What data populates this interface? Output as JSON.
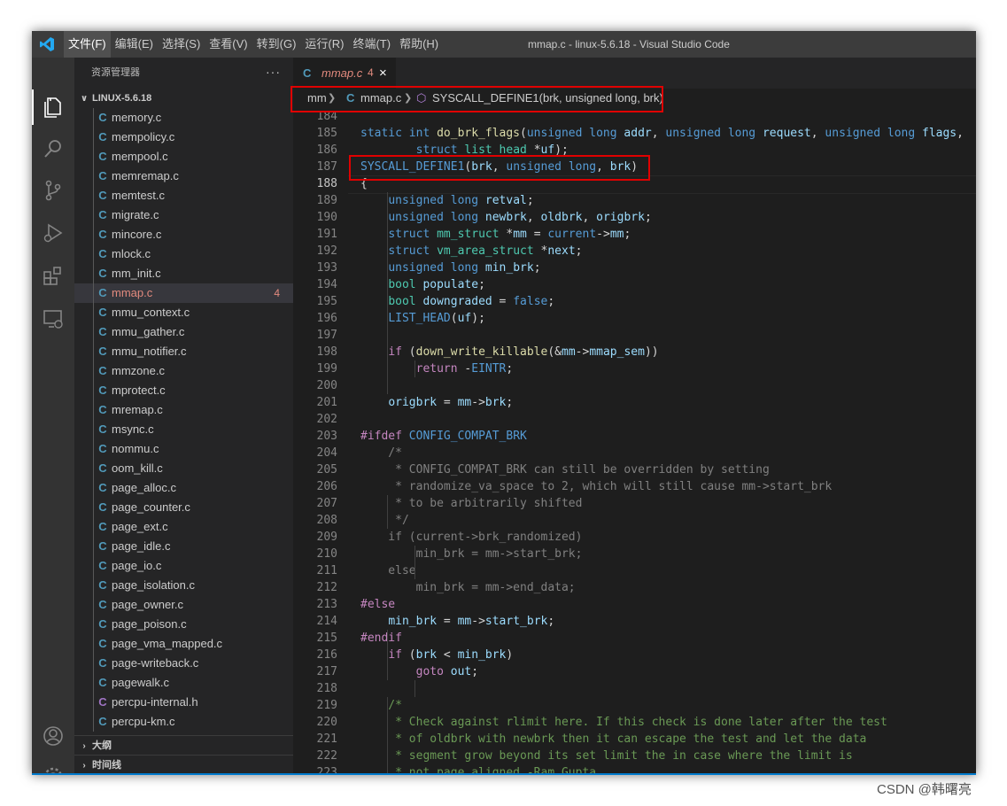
{
  "window": {
    "title": "mmap.c - linux-5.6.18 - Visual Studio Code"
  },
  "menu": [
    {
      "label": "文件(F)",
      "active": true
    },
    {
      "label": "编辑(E)"
    },
    {
      "label": "选择(S)"
    },
    {
      "label": "查看(V)"
    },
    {
      "label": "转到(G)"
    },
    {
      "label": "运行(R)"
    },
    {
      "label": "终端(T)"
    },
    {
      "label": "帮助(H)"
    }
  ],
  "activity_icons": [
    "files-icon",
    "search-icon",
    "source-control-icon",
    "run-debug-icon",
    "extensions-icon",
    "remote-explorer-icon",
    "account-icon",
    "settings-gear-icon"
  ],
  "sidebar": {
    "header": "资源管理器",
    "more": "···",
    "folder": "LINUX-5.6.18",
    "files": [
      {
        "icon": "C",
        "name": "memory.c"
      },
      {
        "icon": "C",
        "name": "mempolicy.c"
      },
      {
        "icon": "C",
        "name": "mempool.c"
      },
      {
        "icon": "C",
        "name": "memremap.c"
      },
      {
        "icon": "C",
        "name": "memtest.c"
      },
      {
        "icon": "C",
        "name": "migrate.c"
      },
      {
        "icon": "C",
        "name": "mincore.c"
      },
      {
        "icon": "C",
        "name": "mlock.c"
      },
      {
        "icon": "C",
        "name": "mm_init.c"
      },
      {
        "icon": "C",
        "name": "mmap.c",
        "active": true,
        "badge": "4"
      },
      {
        "icon": "C",
        "name": "mmu_context.c"
      },
      {
        "icon": "C",
        "name": "mmu_gather.c"
      },
      {
        "icon": "C",
        "name": "mmu_notifier.c"
      },
      {
        "icon": "C",
        "name": "mmzone.c"
      },
      {
        "icon": "C",
        "name": "mprotect.c"
      },
      {
        "icon": "C",
        "name": "mremap.c"
      },
      {
        "icon": "C",
        "name": "msync.c"
      },
      {
        "icon": "C",
        "name": "nommu.c"
      },
      {
        "icon": "C",
        "name": "oom_kill.c"
      },
      {
        "icon": "C",
        "name": "page_alloc.c"
      },
      {
        "icon": "C",
        "name": "page_counter.c"
      },
      {
        "icon": "C",
        "name": "page_ext.c"
      },
      {
        "icon": "C",
        "name": "page_idle.c"
      },
      {
        "icon": "C",
        "name": "page_io.c"
      },
      {
        "icon": "C",
        "name": "page_isolation.c"
      },
      {
        "icon": "C",
        "name": "page_owner.c"
      },
      {
        "icon": "C",
        "name": "page_poison.c"
      },
      {
        "icon": "C",
        "name": "page_vma_mapped.c"
      },
      {
        "icon": "C",
        "name": "page-writeback.c"
      },
      {
        "icon": "C",
        "name": "pagewalk.c"
      },
      {
        "icon": "C",
        "name": "percpu-internal.h",
        "header": true
      },
      {
        "icon": "C",
        "name": "percpu-km.c"
      }
    ],
    "outline": "大纲",
    "timeline": "时间线"
  },
  "tab": {
    "icon": "C",
    "name": "mmap.c",
    "badge": "4",
    "close": "×"
  },
  "breadcrumb": {
    "folder": "mm",
    "file": "mmap.c",
    "symbol": "SYSCALL_DEFINE1(brk, unsigned long, brk)",
    "file_icon": "C"
  },
  "colors": {
    "keyword": "#569cd6",
    "type": "#4ec9b0",
    "func": "#dcdcaa",
    "var": "#9cdcfe",
    "comment": "#6a9955",
    "string": "#ce9178",
    "text": "#d4d4d4",
    "macro": "#569cd6",
    "control": "#c586c0",
    "inactive": "#808080",
    "accent": "#007acc",
    "highlight": "#e00000"
  },
  "code": {
    "current_line": 188,
    "lines": [
      {
        "n": 184,
        "t": [
          [
            "",
            "t"
          ]
        ]
      },
      {
        "n": 185,
        "t": [
          [
            "static int ",
            "k"
          ],
          [
            "do_brk_flags",
            "f"
          ],
          [
            "(",
            "t"
          ],
          [
            "unsigned long ",
            "k"
          ],
          [
            "addr",
            "v"
          ],
          [
            ", ",
            "t"
          ],
          [
            "unsigned long ",
            "k"
          ],
          [
            "request",
            "v"
          ],
          [
            ", ",
            "t"
          ],
          [
            "unsigned long ",
            "k"
          ],
          [
            "flags",
            "v"
          ],
          [
            ",",
            "t"
          ]
        ]
      },
      {
        "n": 186,
        "t": [
          [
            "        ",
            "t"
          ],
          [
            "struct ",
            "k"
          ],
          [
            "list_head ",
            "ty"
          ],
          [
            "*",
            "t"
          ],
          [
            "uf",
            "v"
          ],
          [
            ");",
            "t"
          ]
        ]
      },
      {
        "n": 187,
        "t": [
          [
            "SYSCALL_DEFINE1",
            "k"
          ],
          [
            "(",
            "t"
          ],
          [
            "brk",
            "v"
          ],
          [
            ", ",
            "t"
          ],
          [
            "unsigned long",
            "k"
          ],
          [
            ", ",
            "t"
          ],
          [
            "brk",
            "v"
          ],
          [
            ")",
            "t"
          ]
        ]
      },
      {
        "n": 188,
        "t": [
          [
            "{",
            "t"
          ]
        ]
      },
      {
        "n": 189,
        "t": [
          [
            "    ",
            "t"
          ],
          [
            "unsigned long ",
            "k"
          ],
          [
            "retval",
            "v"
          ],
          [
            ";",
            "t"
          ]
        ]
      },
      {
        "n": 190,
        "t": [
          [
            "    ",
            "t"
          ],
          [
            "unsigned long ",
            "k"
          ],
          [
            "newbrk",
            "v"
          ],
          [
            ", ",
            "t"
          ],
          [
            "oldbrk",
            "v"
          ],
          [
            ", ",
            "t"
          ],
          [
            "origbrk",
            "v"
          ],
          [
            ";",
            "t"
          ]
        ]
      },
      {
        "n": 191,
        "t": [
          [
            "    ",
            "t"
          ],
          [
            "struct ",
            "k"
          ],
          [
            "mm_struct ",
            "ty"
          ],
          [
            "*",
            "t"
          ],
          [
            "mm",
            "v"
          ],
          [
            " = ",
            "t"
          ],
          [
            "current",
            "k"
          ],
          [
            "->",
            "t"
          ],
          [
            "mm",
            "v"
          ],
          [
            ";",
            "t"
          ]
        ]
      },
      {
        "n": 192,
        "t": [
          [
            "    ",
            "t"
          ],
          [
            "struct ",
            "k"
          ],
          [
            "vm_area_struct ",
            "ty"
          ],
          [
            "*",
            "t"
          ],
          [
            "next",
            "v"
          ],
          [
            ";",
            "t"
          ]
        ]
      },
      {
        "n": 193,
        "t": [
          [
            "    ",
            "t"
          ],
          [
            "unsigned long ",
            "k"
          ],
          [
            "min_brk",
            "v"
          ],
          [
            ";",
            "t"
          ]
        ]
      },
      {
        "n": 194,
        "t": [
          [
            "    ",
            "t"
          ],
          [
            "bool ",
            "ty"
          ],
          [
            "populate",
            "v"
          ],
          [
            ";",
            "t"
          ]
        ]
      },
      {
        "n": 195,
        "t": [
          [
            "    ",
            "t"
          ],
          [
            "bool ",
            "ty"
          ],
          [
            "downgraded",
            "v"
          ],
          [
            " = ",
            "t"
          ],
          [
            "false",
            "k"
          ],
          [
            ";",
            "t"
          ]
        ]
      },
      {
        "n": 196,
        "t": [
          [
            "    ",
            "t"
          ],
          [
            "LIST_HEAD",
            "k"
          ],
          [
            "(",
            "t"
          ],
          [
            "uf",
            "v"
          ],
          [
            ");",
            "t"
          ]
        ]
      },
      {
        "n": 197,
        "t": [
          [
            "",
            "t"
          ]
        ]
      },
      {
        "n": 198,
        "t": [
          [
            "    ",
            "t"
          ],
          [
            "if",
            "c"
          ],
          [
            " (",
            "t"
          ],
          [
            "down_write_killable",
            "f"
          ],
          [
            "(&",
            "t"
          ],
          [
            "mm",
            "v"
          ],
          [
            "->",
            "t"
          ],
          [
            "mmap_sem",
            "v"
          ],
          [
            "))",
            "t"
          ]
        ]
      },
      {
        "n": 199,
        "t": [
          [
            "        ",
            "t"
          ],
          [
            "return",
            "c"
          ],
          [
            " -",
            "t"
          ],
          [
            "EINTR",
            "k"
          ],
          [
            ";",
            "t"
          ]
        ]
      },
      {
        "n": 200,
        "t": [
          [
            "",
            "t"
          ]
        ]
      },
      {
        "n": 201,
        "t": [
          [
            "    ",
            "t"
          ],
          [
            "origbrk",
            "v"
          ],
          [
            " = ",
            "t"
          ],
          [
            "mm",
            "v"
          ],
          [
            "->",
            "t"
          ],
          [
            "brk",
            "v"
          ],
          [
            ";",
            "t"
          ]
        ]
      },
      {
        "n": 202,
        "t": [
          [
            "",
            "t"
          ]
        ]
      },
      {
        "n": 203,
        "t": [
          [
            "#ifdef ",
            "c"
          ],
          [
            "CONFIG_COMPAT_BRK",
            "k"
          ]
        ]
      },
      {
        "n": 204,
        "t": [
          [
            "    /*",
            "i"
          ]
        ]
      },
      {
        "n": 205,
        "t": [
          [
            "     * CONFIG_COMPAT_BRK can still be overridden by setting",
            "i"
          ]
        ]
      },
      {
        "n": 206,
        "t": [
          [
            "     * randomize_va_space to 2, which will still cause mm->start_brk",
            "i"
          ]
        ]
      },
      {
        "n": 207,
        "t": [
          [
            "     * to be arbitrarily shifted",
            "i"
          ]
        ]
      },
      {
        "n": 208,
        "t": [
          [
            "     */",
            "i"
          ]
        ]
      },
      {
        "n": 209,
        "t": [
          [
            "    if (current->brk_randomized)",
            "i"
          ]
        ]
      },
      {
        "n": 210,
        "t": [
          [
            "        min_brk = mm->start_brk;",
            "i"
          ]
        ]
      },
      {
        "n": 211,
        "t": [
          [
            "    else",
            "i"
          ]
        ]
      },
      {
        "n": 212,
        "t": [
          [
            "        min_brk = mm->end_data;",
            "i"
          ]
        ]
      },
      {
        "n": 213,
        "t": [
          [
            "#else",
            "c"
          ]
        ]
      },
      {
        "n": 214,
        "t": [
          [
            "    ",
            "t"
          ],
          [
            "min_brk",
            "v"
          ],
          [
            " = ",
            "t"
          ],
          [
            "mm",
            "v"
          ],
          [
            "->",
            "t"
          ],
          [
            "start_brk",
            "v"
          ],
          [
            ";",
            "t"
          ]
        ]
      },
      {
        "n": 215,
        "t": [
          [
            "#endif",
            "c"
          ]
        ]
      },
      {
        "n": 216,
        "t": [
          [
            "    ",
            "t"
          ],
          [
            "if",
            "c"
          ],
          [
            " (",
            "t"
          ],
          [
            "brk",
            "v"
          ],
          [
            " < ",
            "t"
          ],
          [
            "min_brk",
            "v"
          ],
          [
            ")",
            "t"
          ]
        ]
      },
      {
        "n": 217,
        "t": [
          [
            "        ",
            "t"
          ],
          [
            "goto",
            "c"
          ],
          [
            " ",
            "t"
          ],
          [
            "out",
            "v"
          ],
          [
            ";",
            "t"
          ]
        ]
      },
      {
        "n": 218,
        "t": [
          [
            "",
            "t"
          ]
        ]
      },
      {
        "n": 219,
        "t": [
          [
            "    /*",
            "cm"
          ]
        ]
      },
      {
        "n": 220,
        "t": [
          [
            "     * Check against rlimit here. If this check is done later after the test",
            "cm"
          ]
        ]
      },
      {
        "n": 221,
        "t": [
          [
            "     * of oldbrk with newbrk then it can escape the test and let the data",
            "cm"
          ]
        ]
      },
      {
        "n": 222,
        "t": [
          [
            "     * segment grow beyond its set limit the in case where the limit is",
            "cm"
          ]
        ]
      },
      {
        "n": 223,
        "t": [
          [
            "     * not page aligned -Ram Gupta",
            "cm"
          ]
        ]
      }
    ]
  },
  "watermark": "CSDN @韩曙亮"
}
